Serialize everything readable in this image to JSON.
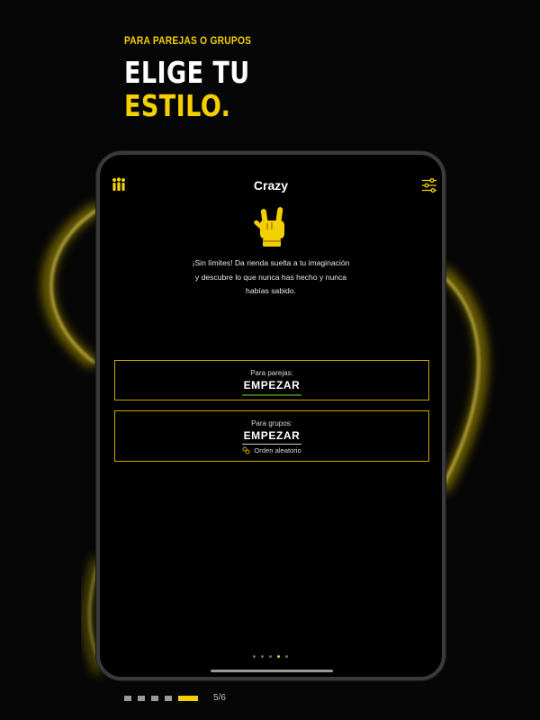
{
  "promo": {
    "eyebrow": "PARA PAREJAS O GRUPOS",
    "title_line1": "ELIGE TU",
    "title_line2": "ESTILO."
  },
  "screen": {
    "title": "Crazy",
    "description": "¡Sin límites! Da rienda suelta a tu imaginación y descubre lo que nunca has hecho y nunca habías sabido.",
    "icons": {
      "left": "group-icon",
      "right": "sliders-icon",
      "illustration": "rock-hand-icon",
      "random": "shuffle-icon"
    },
    "couples_card": {
      "label": "Para parejas:",
      "action": "EMPEZAR"
    },
    "groups_card": {
      "label": "Para grupos:",
      "action": "EMPEZAR",
      "option": "Orden aleatorio"
    },
    "carousel": {
      "total": 5,
      "active_index": 3
    }
  },
  "pager": {
    "current": 5,
    "total": 6,
    "text": "5/6"
  },
  "colors": {
    "accent": "#f5d000",
    "background": "#060606",
    "card_border": "#c9a400"
  }
}
